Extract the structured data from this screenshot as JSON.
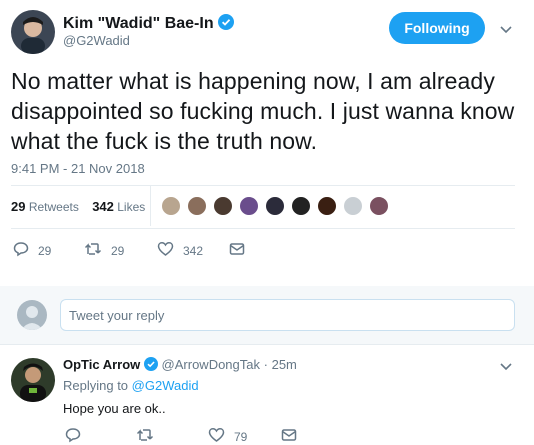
{
  "tweet": {
    "author_name": "Kim \"Wadid\" Bae-In",
    "author_handle": "@G2Wadid",
    "follow_label": "Following",
    "text": "No matter what is happening now, I am already disappointed so fucking much. I just wanna know what the fuck is the truth now.",
    "timestamp": "9:41 PM - 21 Nov 2018",
    "retweets_count": "29",
    "retweets_label": "Retweets",
    "likes_count": "342",
    "likes_label": "Likes",
    "actions": {
      "replies": "29",
      "retweets": "29",
      "likes": "342"
    }
  },
  "reply_box": {
    "placeholder": "Tweet your reply"
  },
  "reply": {
    "author_name": "OpTic Arrow",
    "author_handle": "@ArrowDongTak",
    "separator": "·",
    "age": "25m",
    "replying_to_prefix": "Replying to",
    "replying_to_handle": "@G2Wadid",
    "text": "Hope you are ok..",
    "actions": {
      "likes": "79"
    }
  },
  "colors": {
    "accent": "#1da1f2",
    "muted": "#657786",
    "divider": "#e6ecf0"
  },
  "icons": [
    "verified-icon",
    "chevron-down-icon",
    "reply-icon",
    "retweet-icon",
    "like-icon",
    "dm-icon"
  ]
}
